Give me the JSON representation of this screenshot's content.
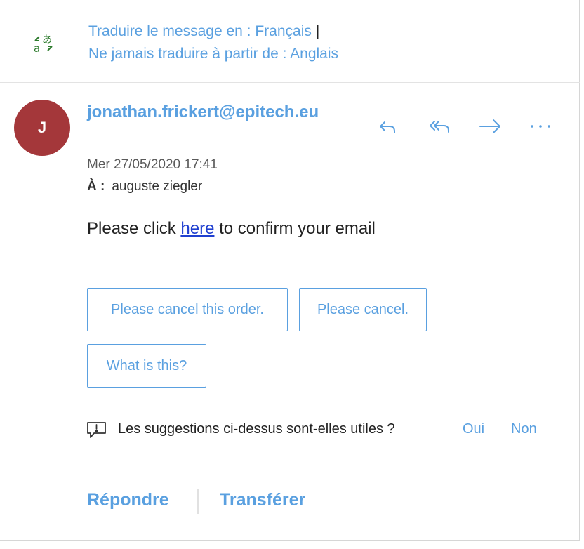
{
  "translation": {
    "translate_to": "Traduire le message en : Français",
    "never_translate": "Ne jamais traduire à partir de : Anglais",
    "icon": "translate-icon",
    "color": "#5aa0e0"
  },
  "message": {
    "avatar_initial": "J",
    "avatar_color": "#a4373a",
    "sender": "jonathan.frickert@epitech.eu",
    "date": "Mer 27/05/2020 17:41",
    "to_label": "À :",
    "to_value": "auguste ziegler",
    "body_before": "Please click ",
    "body_link": "here",
    "body_after": " to confirm your email"
  },
  "actions": {
    "reply_icon": "reply-icon",
    "reply_all_icon": "reply-all-icon",
    "forward_icon": "forward-icon",
    "more_icon": "more-icon"
  },
  "suggestions": [
    "Please cancel this order.",
    "Please cancel.",
    "What is this?"
  ],
  "feedback": {
    "question": "Les suggestions ci-dessus sont-elles utiles ?",
    "yes": "Oui",
    "no": "Non"
  },
  "footer": {
    "reply": "Répondre",
    "forward": "Transférer"
  }
}
